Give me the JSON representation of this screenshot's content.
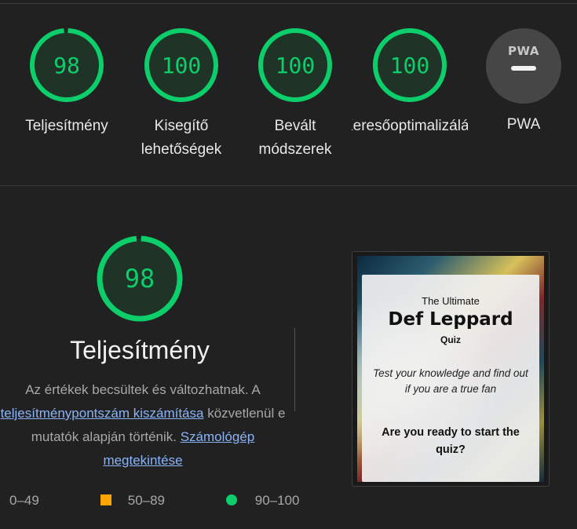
{
  "summary_gauges": [
    {
      "score": "98",
      "label_line1": "Teljesítmény",
      "label_line2": "",
      "fraction": 0.98
    },
    {
      "score": "100",
      "label_line1": "Kisegítő",
      "label_line2": "lehetőségek",
      "fraction": 1.0
    },
    {
      "score": "100",
      "label_line1": "Bevált",
      "label_line2": "módszerek",
      "fraction": 1.0
    },
    {
      "score": "100",
      "label_line1": "Keresőoptimalizálás",
      "label_line2": "",
      "fraction": 1.0
    }
  ],
  "pwa": {
    "badge": "PWA",
    "label": "PWA"
  },
  "performance": {
    "score": "98",
    "fraction": 0.98,
    "title": "Teljesítmény",
    "desc_part1": "Az értékek becsültek és változhatnak. A",
    "link_calc": "teljesítménypontszám kiszámítása",
    "desc_part2": " közvetlenül e",
    "desc_part3": "mutatók alapján történik. ",
    "link_calculator_1": "Számológép",
    "link_calculator_2": "megtekintése"
  },
  "legend": {
    "fail": "0–49",
    "average": "50–89",
    "pass": "90–100"
  },
  "screenshot": {
    "pre_title": "The Ultimate",
    "title": "Def Leppard",
    "sub": "Quiz",
    "desc": "Test your knowledge and find out if you are a true fan",
    "ask": "Are you ready to start the quiz?"
  },
  "colors": {
    "pass": "#0cce6b",
    "average": "#ffa400",
    "fail": "#ff4e42",
    "track": "#1f3a2a"
  }
}
